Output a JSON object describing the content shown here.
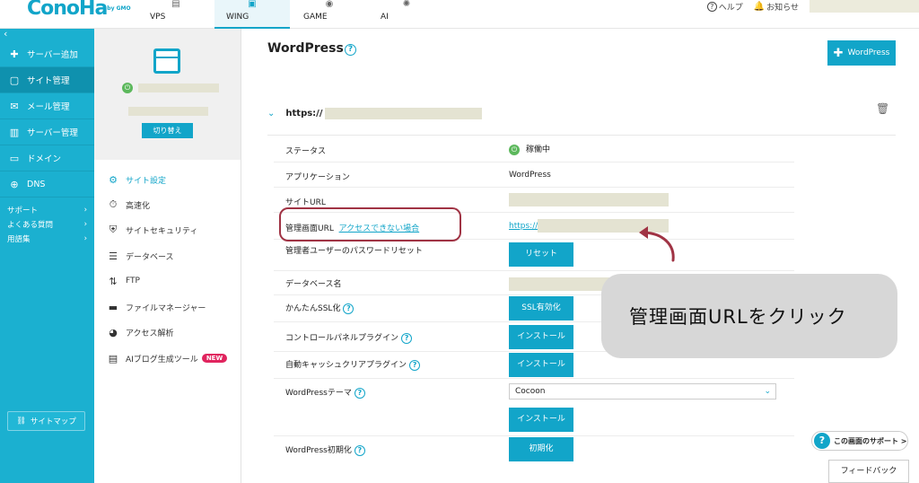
{
  "header": {
    "logo": "ConoHa",
    "logo_sub": "by GMO",
    "nav": [
      {
        "label": "VPS",
        "icon": "server-icon"
      },
      {
        "label": "WING",
        "icon": "wing-icon"
      },
      {
        "label": "GAME",
        "icon": "gamepad-icon"
      },
      {
        "label": "AI",
        "icon": "ai-icon"
      }
    ],
    "help": "ヘルプ",
    "notice": "お知らせ"
  },
  "sidebar": {
    "items": [
      {
        "label": "サーバー追加",
        "icon": "plus-icon"
      },
      {
        "label": "サイト管理",
        "icon": "window-icon"
      },
      {
        "label": "メール管理",
        "icon": "mail-icon"
      },
      {
        "label": "サーバー管理",
        "icon": "server-icon"
      },
      {
        "label": "ドメイン",
        "icon": "domain-icon"
      },
      {
        "label": "DNS",
        "icon": "globe-icon"
      }
    ],
    "small_items": [
      {
        "label": "サポート"
      },
      {
        "label": "よくある質問"
      },
      {
        "label": "用語集"
      }
    ],
    "sitemap": "サイトマップ"
  },
  "site_panel": {
    "switch_label": "切り替え",
    "menu": [
      {
        "label": "サイト設定",
        "icon": "settings-icon"
      },
      {
        "label": "高速化",
        "icon": "stopwatch-icon"
      },
      {
        "label": "サイトセキュリティ",
        "icon": "shield-icon"
      },
      {
        "label": "データベース",
        "icon": "database-icon"
      },
      {
        "label": "FTP",
        "icon": "transfer-icon"
      },
      {
        "label": "ファイルマネージャー",
        "icon": "folder-icon"
      },
      {
        "label": "アクセス解析",
        "icon": "pie-chart-icon"
      },
      {
        "label": "AIブログ生成ツール",
        "icon": "document-icon"
      }
    ],
    "new_badge": "NEW"
  },
  "main": {
    "title": "WordPress",
    "add_button": "WordPress",
    "url_prefix": "https://",
    "rows": {
      "status_label": "ステータス",
      "status_value": "稼働中",
      "app_label": "アプリケーション",
      "app_value": "WordPress",
      "site_url_label": "サイトURL",
      "admin_url_label": "管理画面URL",
      "admin_url_help": "アクセスできない場合",
      "admin_url_value": "https://",
      "pw_reset_label": "管理者ユーザーのパスワードリセット",
      "pw_reset_button": "リセット",
      "db_label": "データベース名",
      "ssl_label": "かんたんSSL化",
      "ssl_button": "SSL有効化",
      "cp_plugin_label": "コントロールパネルプラグイン",
      "cp_plugin_button": "インストール",
      "cache_plugin_label": "自動キャッシュクリアプラグイン",
      "cache_plugin_button": "インストール",
      "theme_label": "WordPressテーマ",
      "theme_value": "Cocoon",
      "theme_button": "インストール",
      "init_label": "WordPress初期化",
      "init_button": "初期化"
    }
  },
  "annotation": "管理画面URLをクリック",
  "support_button": "この画面のサポート >",
  "feedback_button": "フィードバック",
  "colors": {
    "accent": "#12a5c9",
    "sidebar": "#1bb0d0",
    "highlight": "#a03344",
    "status_ok": "#5cb85c"
  }
}
